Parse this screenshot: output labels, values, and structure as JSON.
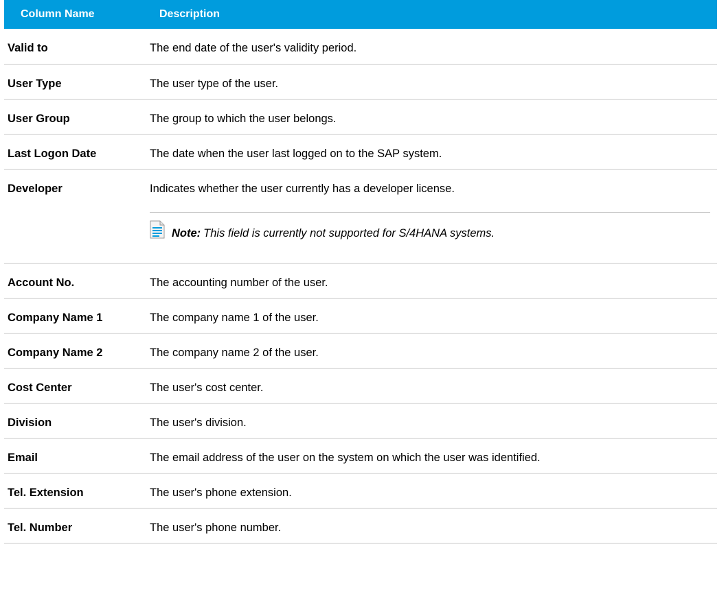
{
  "table": {
    "headers": [
      "Column Name",
      "Description"
    ],
    "rows": [
      {
        "name": "Valid to",
        "description": "The end date of the user's validity period."
      },
      {
        "name": "User Type",
        "description": "The user type of the user."
      },
      {
        "name": "User Group",
        "description": "The group to which the user belongs."
      },
      {
        "name": "Last Logon Date",
        "description": "The date when the user last logged on to the SAP system."
      },
      {
        "name": "Developer",
        "description": "Indicates whether the user currently has a developer license."
      },
      {
        "name": "Account No.",
        "description": "The accounting number of the user."
      },
      {
        "name": "Company Name 1",
        "description": "The company name 1 of the user."
      },
      {
        "name": "Company Name 2",
        "description": "The company name 2 of the user."
      },
      {
        "name": "Cost Center",
        "description": "The user's cost center."
      },
      {
        "name": "Division",
        "description": "The user's division."
      },
      {
        "name": "Email",
        "description": "The email address of the user on the system on which the user was identified."
      },
      {
        "name": "Tel. Extension",
        "description": "The user's phone extension."
      },
      {
        "name": "Tel. Number",
        "description": "The user's phone number."
      }
    ]
  },
  "note": {
    "label": "Note:",
    "text": "This field is currently not supported for S/4HANA systems.",
    "icon": "note-document-icon"
  },
  "colors": {
    "header_bg": "#009cdd",
    "header_text": "#ffffff",
    "divider": "#c8c8c8",
    "note_icon_accent": "#009cdd"
  }
}
